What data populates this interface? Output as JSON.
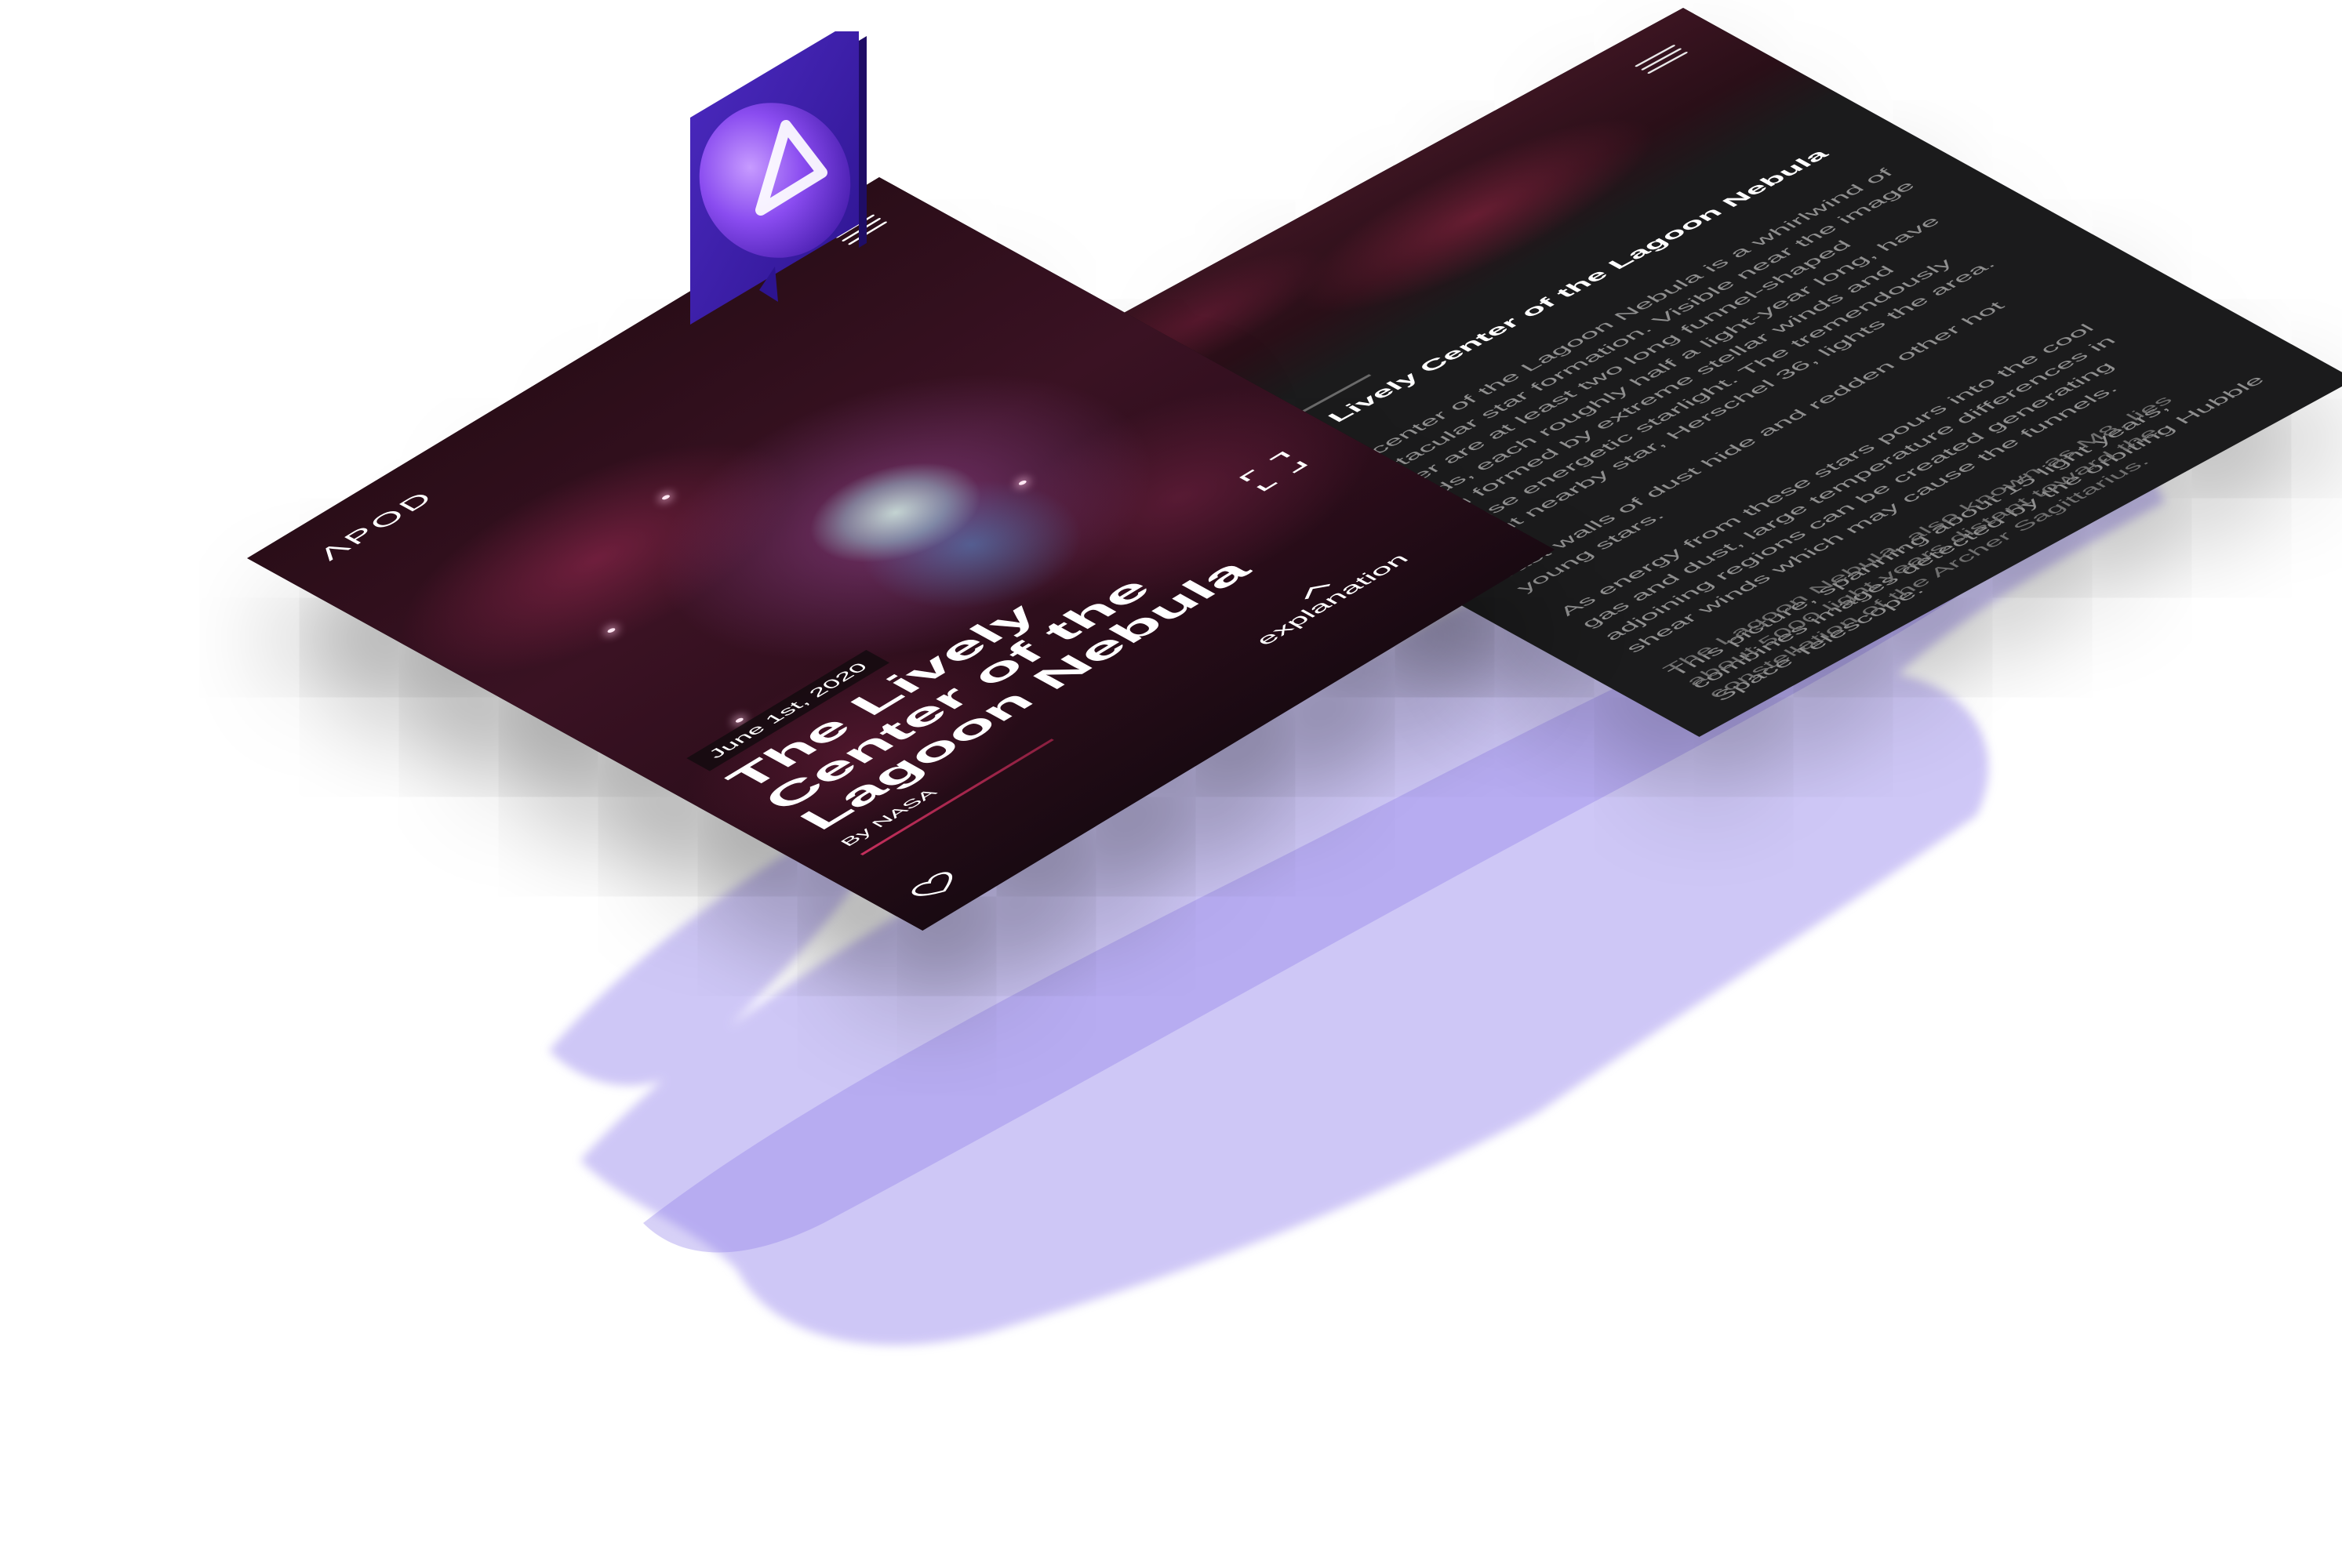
{
  "app": {
    "logo_text": "ΛPOD",
    "icon_name": "apod-triangle-app-icon"
  },
  "hero": {
    "date": "June 1st, 2020",
    "title": "The Lively Center of the Lagoon Nebula",
    "byline": "By NASA",
    "explanation_label": "explanation",
    "menu_icon": "hamburger-menu-icon",
    "fullscreen_icon": "fullscreen-expand-icon",
    "favorite_icon": "heart-icon",
    "explanation_icon": "chevron-up-icon"
  },
  "detail": {
    "title": "The Lively Center of the Lagoon Nebula",
    "paragraphs": [
      "The center of the Lagoon Nebula is a whirlwind of spectacular star formation. Visible near the image center are at least two long funnel-shaped clouds, each roughly half a light-year long, have been formed by extreme stellar winds and intense energetic starlight. The tremendously bright nearby star, Herschel 36, lights the area.",
      "Vast walls of dust hide and redden other hot young stars.",
      "As energy from these stars pours into the cool gas and dust, large temperature differences in adjoining regions can be created generating shear winds which may cause the funnels.",
      "This picture, spanning about 15 light years, combines images detected by the orbiting Hubble Space Telescope."
    ],
    "footer": "The Lagoon Nebula, also known as M8, lies about 5000 light years distant toward the constellation of the Archer Sagittarius.",
    "menu_icon": "hamburger-menu-icon"
  },
  "colors": {
    "accent": "#c42f5c",
    "brand_purple": "#4a1fb0",
    "dark_panel": "#1b1b1c",
    "brush": "#8f7fe0"
  }
}
